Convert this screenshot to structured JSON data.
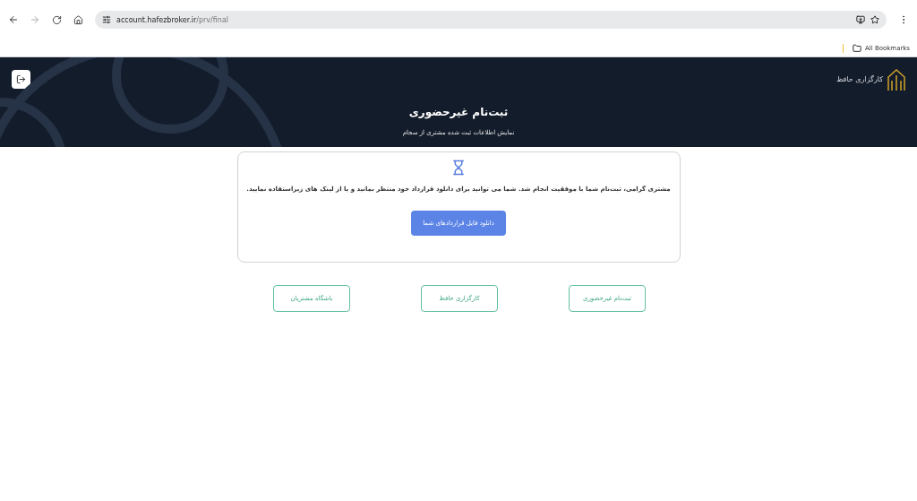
{
  "browser": {
    "url_host": "account.hafezbroker.ir",
    "url_path": "/prv/final",
    "bookmarks_label": "All Bookmarks"
  },
  "header": {
    "brand": "کارگزاری حافظ",
    "title": "ثبت‌نام غیرحضوری",
    "subtitle": "نمایش اطلاعات ثبت شده مشتری از سجام"
  },
  "card": {
    "message": "مشتری گرامی، ثبت‌نام شما با موفقیت انجام شد. شما می توانید برای دانلود قرارداد خود منتظر بمانید و یا از لینک های زیراستفاده نمایید.",
    "button": "دانلود فایل قراردادهای شما"
  },
  "links": [
    "ثبت‌نام غیرحضوری",
    "کارگزاری حافظ",
    "باشگاه مشتریان"
  ]
}
